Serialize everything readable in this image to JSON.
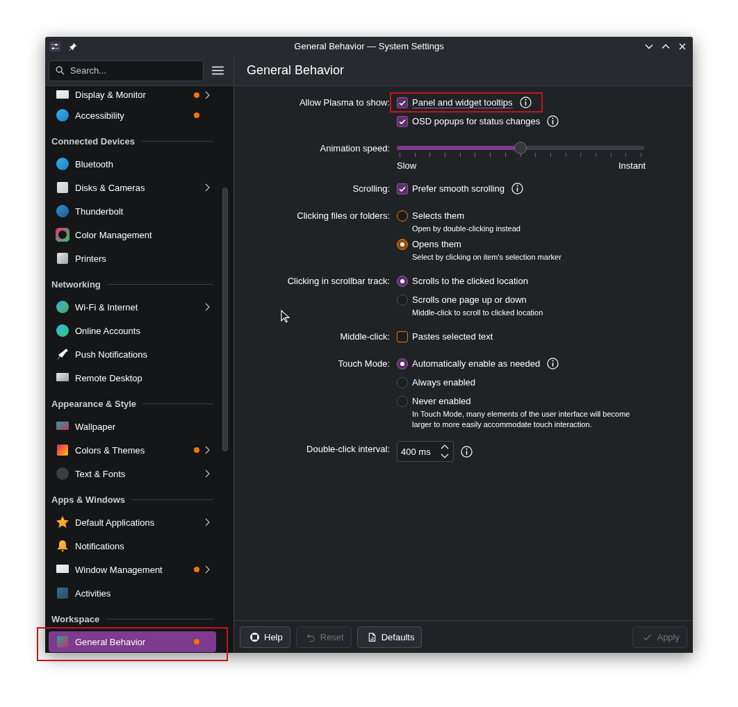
{
  "window": {
    "title": "General Behavior — System Settings"
  },
  "search": {
    "placeholder": "Search..."
  },
  "page_title": "General Behavior",
  "sidebar": {
    "sections": [
      {
        "items": [
          {
            "label": "Display & Monitor",
            "changed": true,
            "has_children": true,
            "selected": false,
            "highlighted": false
          },
          {
            "label": "Accessibility",
            "changed": true,
            "has_children": false,
            "selected": false,
            "highlighted": false
          }
        ]
      },
      {
        "heading": "Connected Devices",
        "items": [
          {
            "label": "Bluetooth",
            "changed": false,
            "has_children": false,
            "selected": false,
            "highlighted": false
          },
          {
            "label": "Disks & Cameras",
            "changed": false,
            "has_children": true,
            "selected": false,
            "highlighted": false
          },
          {
            "label": "Thunderbolt",
            "changed": false,
            "has_children": false,
            "selected": false,
            "highlighted": false
          },
          {
            "label": "Color Management",
            "changed": false,
            "has_children": false,
            "selected": false,
            "highlighted": false
          },
          {
            "label": "Printers",
            "changed": false,
            "has_children": false,
            "selected": false,
            "highlighted": false
          }
        ]
      },
      {
        "heading": "Networking",
        "items": [
          {
            "label": "Wi-Fi & Internet",
            "changed": false,
            "has_children": true,
            "selected": false,
            "highlighted": false
          },
          {
            "label": "Online Accounts",
            "changed": false,
            "has_children": false,
            "selected": false,
            "highlighted": false
          },
          {
            "label": "Push Notifications",
            "changed": false,
            "has_children": false,
            "selected": false,
            "highlighted": false
          },
          {
            "label": "Remote Desktop",
            "changed": false,
            "has_children": false,
            "selected": false,
            "highlighted": false
          }
        ]
      },
      {
        "heading": "Appearance & Style",
        "items": [
          {
            "label": "Wallpaper",
            "changed": false,
            "has_children": false,
            "selected": false,
            "highlighted": false
          },
          {
            "label": "Colors & Themes",
            "changed": true,
            "has_children": true,
            "selected": false,
            "highlighted": false
          },
          {
            "label": "Text & Fonts",
            "changed": false,
            "has_children": true,
            "selected": false,
            "highlighted": false
          }
        ]
      },
      {
        "heading": "Apps & Windows",
        "items": [
          {
            "label": "Default Applications",
            "changed": false,
            "has_children": true,
            "selected": false,
            "highlighted": false
          },
          {
            "label": "Notifications",
            "changed": false,
            "has_children": false,
            "selected": false,
            "highlighted": false
          },
          {
            "label": "Window Management",
            "changed": true,
            "has_children": true,
            "selected": false,
            "highlighted": false
          },
          {
            "label": "Activities",
            "changed": false,
            "has_children": false,
            "selected": false,
            "highlighted": false
          }
        ]
      },
      {
        "heading": "Workspace",
        "items": [
          {
            "label": "General Behavior",
            "changed": true,
            "has_children": false,
            "selected": true,
            "highlighted": true
          }
        ]
      }
    ]
  },
  "form": [
    {
      "kind": "checks",
      "label": "Allow Plasma to show:",
      "options": [
        {
          "label": "Panel and widget tooltips",
          "checked": true,
          "changed": false,
          "info": true,
          "highlighted": true
        },
        {
          "label": "OSD popups for status changes",
          "checked": true,
          "changed": false,
          "info": true,
          "highlighted": false
        }
      ]
    },
    {
      "kind": "slider",
      "label": "Animation speed:",
      "level": 0.5,
      "min_label": "Slow",
      "max_label": "Instant"
    },
    {
      "kind": "checks",
      "label": "Scrolling:",
      "options": [
        {
          "label": "Prefer smooth scrolling",
          "checked": true,
          "changed": false,
          "info": true,
          "highlighted": false
        }
      ]
    },
    {
      "kind": "radios",
      "label": "Clicking files or folders:",
      "options": [
        {
          "label": "Selects them",
          "hint": "Open by double-clicking instead",
          "selected": false,
          "changed": true,
          "info": false
        },
        {
          "label": "Opens them",
          "hint": "Select by clicking on item's selection marker",
          "selected": true,
          "changed": true,
          "info": false
        }
      ]
    },
    {
      "kind": "radios",
      "label": "Clicking in scrollbar track:",
      "options": [
        {
          "label": "Scrolls to the clicked location",
          "selected": true,
          "changed": false,
          "info": false
        },
        {
          "label": "Scrolls one page up or down",
          "hint": "Middle-click to scroll to clicked location",
          "selected": false,
          "changed": false,
          "info": false
        }
      ]
    },
    {
      "kind": "checks",
      "label": "Middle-click:",
      "options": [
        {
          "label": "Pastes selected text",
          "checked": false,
          "changed": true,
          "info": false,
          "highlighted": false
        }
      ]
    },
    {
      "kind": "radios",
      "label": "Touch Mode:",
      "options": [
        {
          "label": "Automatically enable as needed",
          "selected": true,
          "changed": false,
          "info": true
        },
        {
          "label": "Always enabled",
          "selected": false,
          "changed": false,
          "info": false
        },
        {
          "label": "Never enabled",
          "selected": false,
          "changed": false,
          "info": false
        }
      ],
      "note": "In Touch Mode, many elements of the user interface will become larger to more easily accommodate touch interaction."
    },
    {
      "kind": "spinbox",
      "label": "Double-click interval:",
      "value": "400 ms",
      "info": true
    }
  ],
  "footer": {
    "buttons": [
      {
        "label": "Help",
        "disabled": false
      },
      {
        "label": "Reset",
        "disabled": true
      },
      {
        "label": "Defaults",
        "disabled": false
      },
      {
        "label": "Apply",
        "disabled": true
      }
    ]
  }
}
